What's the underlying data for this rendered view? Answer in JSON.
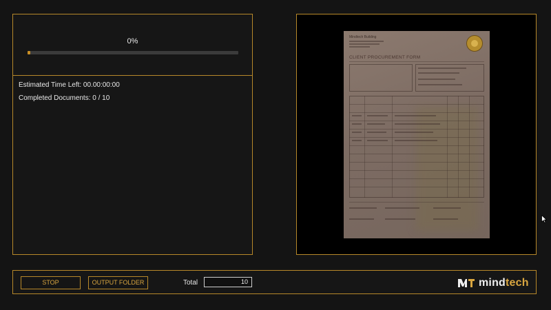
{
  "progress": {
    "percent_label": "0%",
    "fraction": 0.0
  },
  "stats": {
    "time_left": "Estimated Time Left: 00.00:00:00",
    "completed": "Completed Documents: 0 / 10"
  },
  "preview": {
    "company": "Mindtech Building",
    "form_title": "CLIENT PROCUREMENT FORM"
  },
  "toolbar": {
    "stop_label": "STOP",
    "output_label": "OUTPUT FOLDER",
    "total_label": "Total",
    "total_value": "10"
  },
  "brand": {
    "mind": "mind",
    "tech": "tech",
    "accent": "#d9a640",
    "border": "#b8892a"
  },
  "icons": {
    "logo": "mindtech-logo-icon",
    "cursor": "mouse-cursor-icon"
  }
}
